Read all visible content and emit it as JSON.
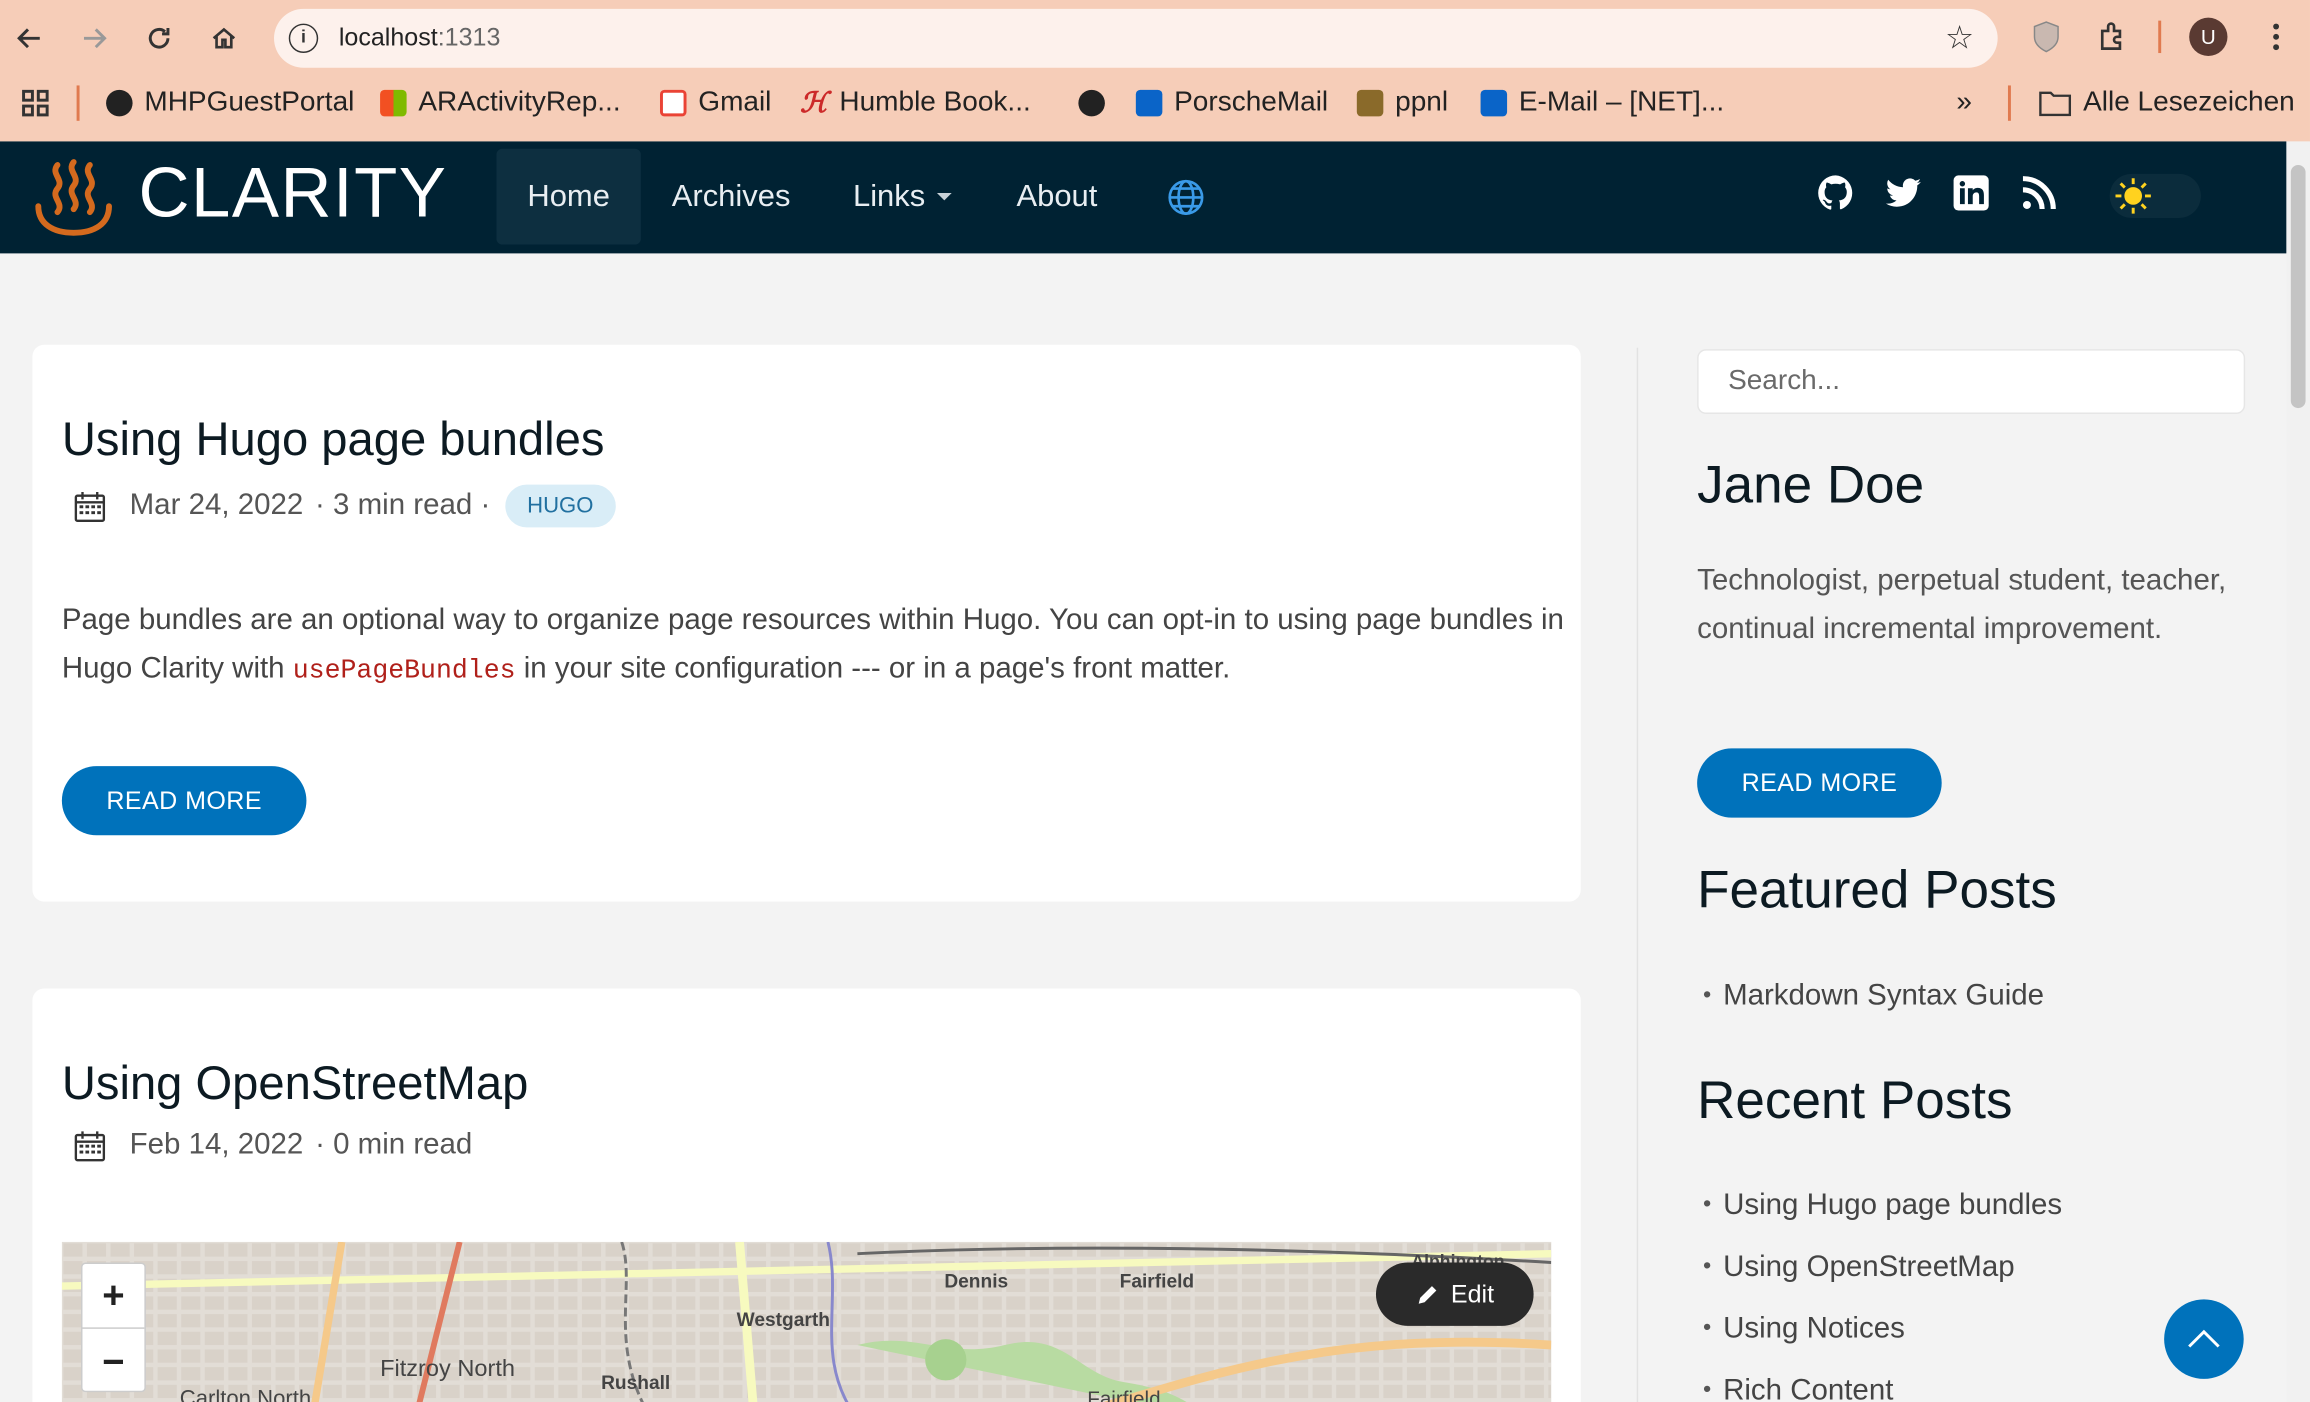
{
  "browser": {
    "url_host": "localhost",
    "url_port": ":1313",
    "avatar_letter": "U",
    "bookmarks": [
      {
        "label": "MHPGuestPortal",
        "color": "#222222"
      },
      {
        "label": "ARActivityRep...",
        "color": "#f25022"
      },
      {
        "label": "Gmail",
        "color": "#ea4335"
      },
      {
        "label": "Humble Book...",
        "color": "#cc2929"
      },
      {
        "label": "",
        "color": "#222222"
      },
      {
        "label": "PorscheMail",
        "color": "#0a64c8"
      },
      {
        "label": "ppnl",
        "color": "#8a6a2a"
      },
      {
        "label": "E-Mail – [NET]...",
        "color": "#0a64c8"
      }
    ],
    "overflow": "»",
    "all_bookmarks": "Alle Lesezeichen"
  },
  "site": {
    "logo": "CLARITY",
    "nav": [
      "Home",
      "Archives",
      "Links",
      "About"
    ],
    "colors": {
      "header": "#002233",
      "accent": "#0072bb"
    }
  },
  "posts": [
    {
      "title": "Using Hugo page bundles",
      "date": "Mar 24, 2022",
      "read": "· 3 min read ·",
      "tag": "HUGO",
      "excerpt_before": "Page bundles are an optional way to organize page resources within Hugo. You can opt-in to using page bundles in Hugo Clarity with ",
      "excerpt_code": "usePageBundles",
      "excerpt_after": " in your site configuration --- or in a page's front matter.",
      "button": "READ MORE"
    },
    {
      "title": "Using OpenStreetMap",
      "date": "Feb 14, 2022",
      "read": "· 0 min read",
      "map": {
        "zoom_in": "+",
        "zoom_out": "−",
        "edit": "Edit",
        "labels": [
          "Dennis",
          "Fairfield",
          "Westgarth",
          "Fitzroy North",
          "Rushall",
          "Carlton North",
          "Alphington",
          "Fairfield"
        ]
      }
    }
  ],
  "sidebar": {
    "search_placeholder": "Search...",
    "author": "Jane Doe",
    "bio": "Technologist, perpetual student, teacher, continual incremental improvement.",
    "button": "READ MORE",
    "featured_title": "Featured Posts",
    "featured": [
      "Markdown Syntax Guide"
    ],
    "recent_title": "Recent Posts",
    "recent": [
      "Using Hugo page bundles",
      "Using OpenStreetMap",
      "Using Notices",
      "Rich Content"
    ]
  }
}
